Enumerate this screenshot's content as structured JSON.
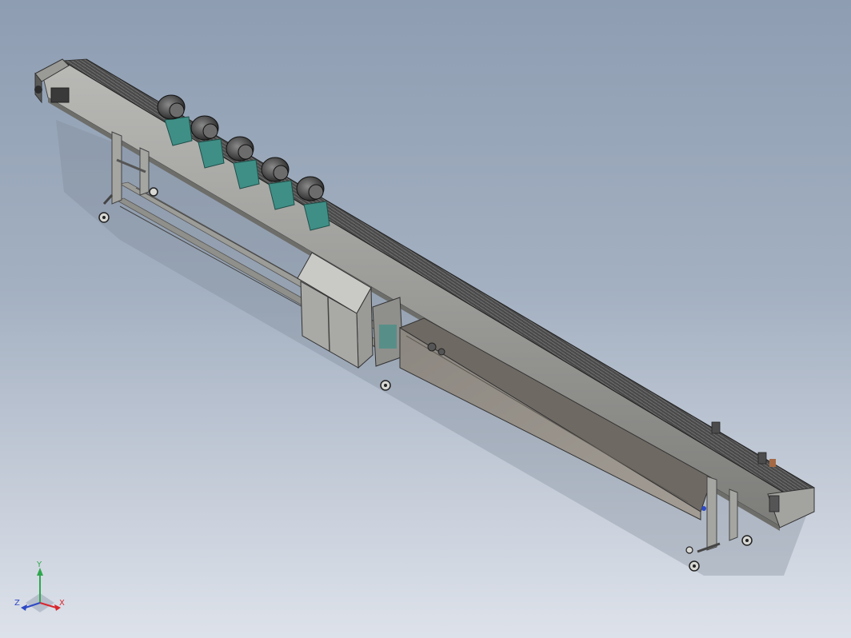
{
  "triad": {
    "x_label": "X",
    "y_label": "Y",
    "z_label": "Z",
    "x_color": "#d8262c",
    "y_color": "#2fa84f",
    "z_color": "#2d49c4"
  },
  "scene": {
    "background_top": "#8e9db2",
    "background_bottom": "#dde2ea",
    "bracket_accent": "#3f8f86",
    "metal": "#8a8a88",
    "belt": "#3b3b3b"
  }
}
